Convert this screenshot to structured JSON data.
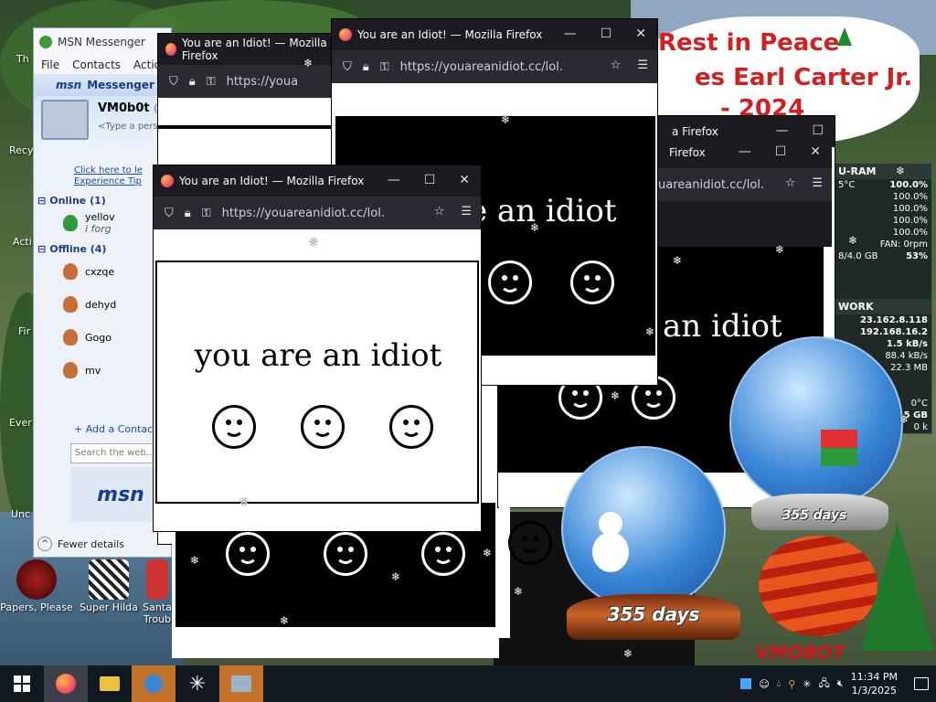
{
  "desktop": {
    "icons": [
      {
        "label": "Papers, Please"
      },
      {
        "label": "Super Hilda"
      },
      {
        "label": "Santa"
      },
      {
        "label": "Troub"
      }
    ],
    "clipped_labels": [
      "Th",
      "Recy",
      "Acti",
      "Fir",
      "Ever",
      "Unc"
    ],
    "rip_banner": {
      "line1": "Rest in Peace",
      "line2": "es Earl Carter Jr.",
      "line3": "- 2024"
    },
    "signature": "VMOBOT"
  },
  "gadget": {
    "cpu_header": "U-RAM",
    "rows": [
      {
        "k": "5°C",
        "v": "100.0%"
      },
      {
        "k": "",
        "v": "100.0%"
      },
      {
        "k": "",
        "v": "100.0%"
      },
      {
        "k": "",
        "v": "100.0%"
      },
      {
        "k": "",
        "v": "100.0%"
      },
      {
        "k": "",
        "v": "FAN: 0rpm"
      },
      {
        "k": "8/4.0 GB",
        "v": "53%"
      }
    ],
    "net_header": "WORK",
    "net_rows": [
      "23.162.8.118",
      "192.168.16.2",
      "1.5 kB/s",
      "88.4 kB/s",
      "22.3 MB"
    ],
    "temp": "0°C",
    "gb": "9.5 GB",
    "k": "0 k"
  },
  "msn": {
    "title": "MSN Messenger",
    "menu": [
      "File",
      "Contacts",
      "Action"
    ],
    "brand": "Messenger",
    "logo": "msn",
    "username": "VM0b0t",
    "username_status": "(O",
    "personal_message": "<Type a pers",
    "help_link_line1": "Click here to le",
    "help_link_line2": "Experience Tip",
    "online_group": "Online (1)",
    "online_contact": "yellov",
    "online_contact_msg": "i forg",
    "offline_group": "Offline (4)",
    "offline_contacts": [
      "cxzqe",
      "dehyd",
      "Gogo",
      "mv"
    ],
    "add_contact": "+ Add a Contact",
    "search_placeholder": "Search the web...",
    "ad_logo": "msn",
    "fewer_details": "Fewer details"
  },
  "firefox": {
    "title": "You are an Idiot! — Mozilla Firefox",
    "title_short": "You are an Idiot! — Mozilla Firefox",
    "title_clip1": "a Firefox",
    "title_clip2": "Firefox",
    "url": "https://youareanidiot.cc/lol.",
    "url_short": "https://youa",
    "url_clip": "uareanidiot.cc/lol.",
    "message": "you are an idiot",
    "message_clip1": "e an idiot",
    "message_clip2": "an idiot"
  },
  "globes": {
    "days_label": "355 days"
  },
  "taskbar": {
    "time": "11:34 PM",
    "date": "1/3/2025"
  }
}
